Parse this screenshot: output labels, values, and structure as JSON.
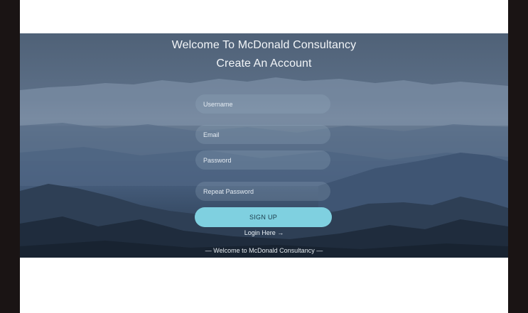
{
  "heading": {
    "welcome": "Welcome To McDonald Consultancy",
    "subtitle": "Create An Account"
  },
  "form": {
    "username_placeholder": "Username",
    "email_placeholder": "Email",
    "password_placeholder": "Password",
    "repeat_password_placeholder": "Repeat Password",
    "signup_label": "SIGN UP",
    "login_link": "Login Here →"
  },
  "footer": {
    "text": "— Welcome to McDonald Consultancy —"
  },
  "colors": {
    "signup_button": "#7fd0e0",
    "frame": "#1a1414"
  }
}
